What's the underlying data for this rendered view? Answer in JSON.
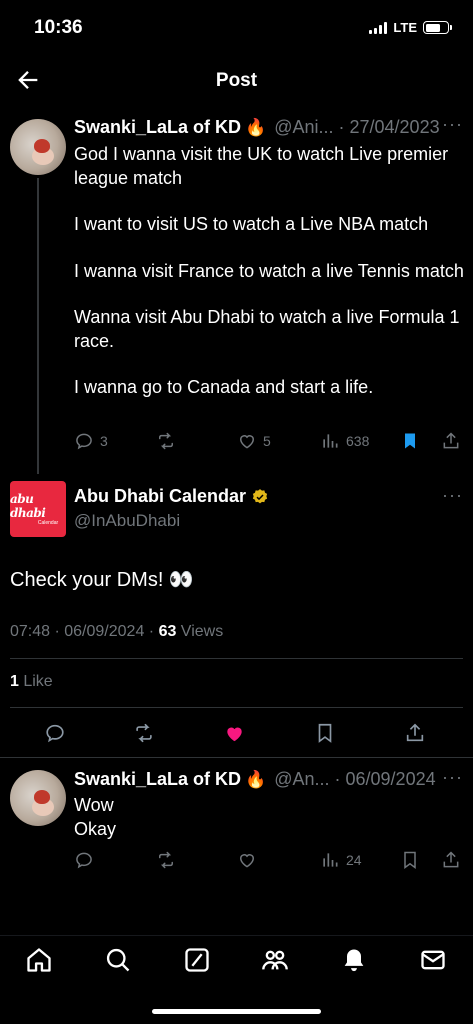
{
  "status_bar": {
    "time": "10:36",
    "network": "LTE",
    "battery_level": 0.7
  },
  "header": {
    "title": "Post"
  },
  "parent_post": {
    "display_name": "Swanki_LaLa of KD",
    "emoji": "🔥",
    "handle_date": "@Ani... · 27/04/2023",
    "more": "···",
    "paragraphs": [
      "God I wanna visit the UK to watch Live premier league match",
      "I want to visit US to watch a Live NBA match",
      "I wanna visit France to watch a live Tennis match",
      "Wanna visit Abu Dhabi to watch a live Formula 1 race.",
      "I wanna go to Canada and start a life."
    ],
    "actions": {
      "replies": "3",
      "reposts": "",
      "likes": "5",
      "views": "638"
    }
  },
  "main_post": {
    "logo_text": "abu dhabi",
    "logo_sub": "Calendar",
    "display_name": "Abu Dhabi Calendar",
    "handle": "@InAbuDhabi",
    "more": "···",
    "text": "Check your DMs! 👀",
    "meta_time": "07:48 · 06/09/2024 · ",
    "views_count": "63",
    "views_label": " Views",
    "likes_count": "1",
    "likes_label": " Like"
  },
  "reply_post": {
    "display_name": "Swanki_LaLa of KD",
    "emoji": "🔥",
    "handle_date": "@An... · 06/09/2024",
    "more": "···",
    "lines": [
      "Wow",
      "Okay"
    ],
    "actions": {
      "replies": "",
      "reposts": "",
      "likes": "",
      "views": "24"
    }
  },
  "colors": {
    "accent": "#1d9bf0",
    "like": "#f91880",
    "muted": "#71767b",
    "bg": "#000000",
    "verified": "#e2b719"
  }
}
